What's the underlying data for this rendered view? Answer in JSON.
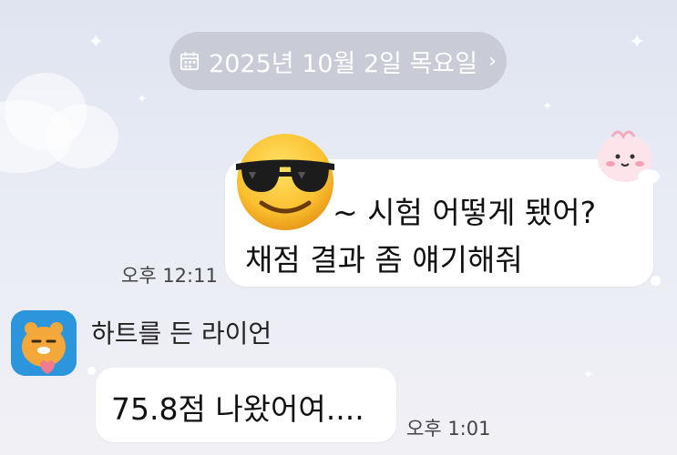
{
  "date_divider": {
    "label": "2025년 10월 2일 목요일",
    "icon": "calendar-icon",
    "chevron": "chevron-right-icon"
  },
  "messages": [
    {
      "direction": "outgoing",
      "text_line1": "~ 시험 어떻게 됐어?",
      "text_line2": "채점 결과 좀 얘기해줘",
      "time": "오후 12:11",
      "cover_emoji": "sunglasses-face-emoji"
    },
    {
      "direction": "incoming",
      "sender": "하트를 든 라이언",
      "text": "75.8점 나왔어여....",
      "time": "오후 1:01",
      "avatar": "lion-with-heart-avatar"
    }
  ],
  "colors": {
    "bubble": "#ffffff",
    "date_pill": "#c9cbd6",
    "avatar_bg": "#2c96dd"
  }
}
